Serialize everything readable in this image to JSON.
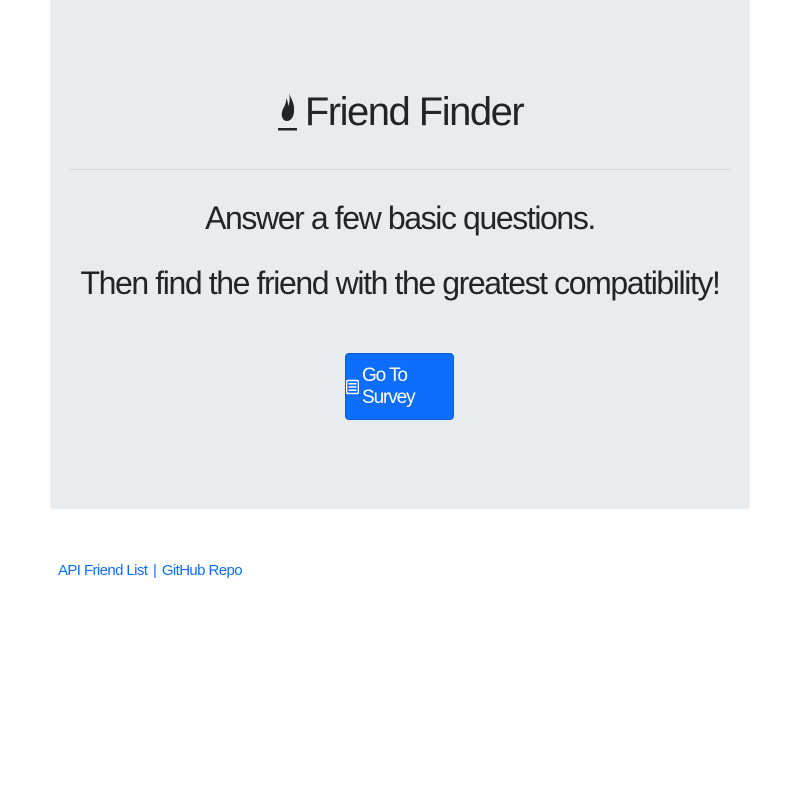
{
  "header": {
    "title": "Friend Finder",
    "icon": "fire-icon"
  },
  "intro": {
    "line1": "Answer a few basic questions.",
    "line2": "Then find the friend with the greatest compatibility!"
  },
  "survey_button": {
    "label": "Go To Survey",
    "icon": "list-alt-icon"
  },
  "footer": {
    "api_link": "API Friend List",
    "separator": "|",
    "github_link": "GitHub Repo"
  },
  "colors": {
    "jumbotron_bg": "#e9ecef",
    "primary": "#0d6efd",
    "text": "#212529"
  }
}
